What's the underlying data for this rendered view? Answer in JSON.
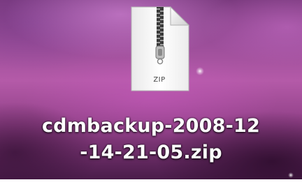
{
  "desktop": {
    "file": {
      "icon": "zip-archive-icon",
      "type_badge": "ZIP",
      "name_line1": "cdmbackup-2008-12",
      "name_line2": "-14-21-05.zip"
    }
  }
}
